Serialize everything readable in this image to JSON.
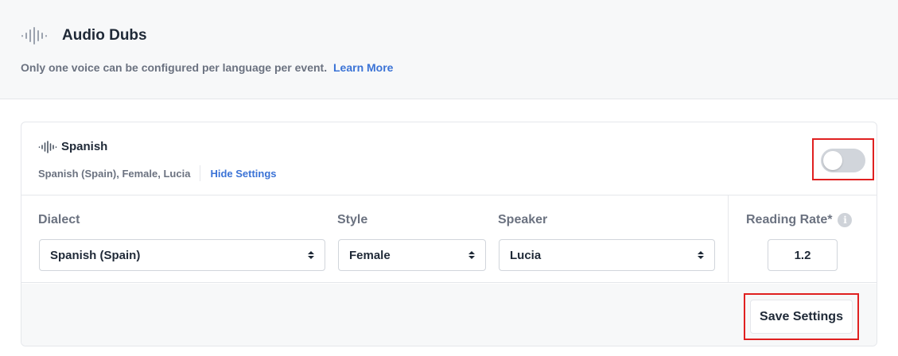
{
  "header": {
    "icon": "audio-waveform-icon",
    "title": "Audio Dubs",
    "note": "Only one voice can be configured per language per event.",
    "learn_more": "Learn More"
  },
  "language": {
    "icon": "audio-waveform-icon",
    "name": "Spanish",
    "summary": "Spanish (Spain), Female, Lucia",
    "hide_settings": "Hide Settings",
    "enabled": false
  },
  "settings": {
    "dialect": {
      "label": "Dialect",
      "value": "Spanish (Spain)"
    },
    "style": {
      "label": "Style",
      "value": "Female"
    },
    "speaker": {
      "label": "Speaker",
      "value": "Lucia"
    },
    "reading_rate": {
      "label": "Reading Rate*",
      "value": "1.2",
      "info_icon": "info-icon"
    }
  },
  "footer": {
    "save_label": "Save Settings"
  },
  "colors": {
    "link": "#3b73d6",
    "highlight": "#e02020",
    "toggle_off": "#d1d5db"
  }
}
